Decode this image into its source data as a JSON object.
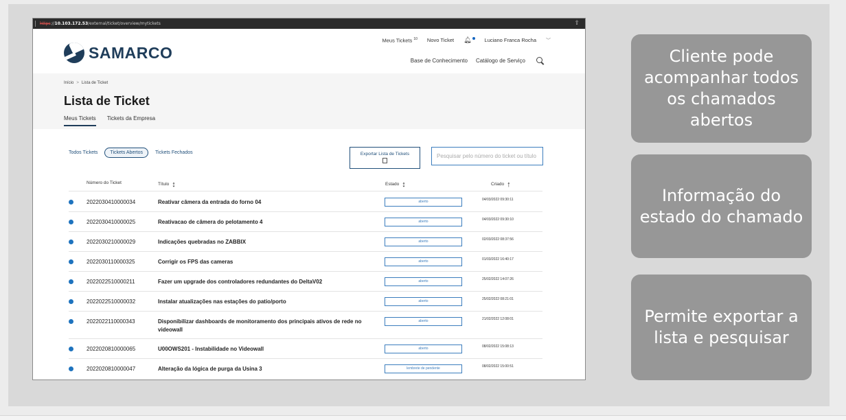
{
  "browser": {
    "url_scheme": "https",
    "url_host": "10.103.172.53",
    "url_path": "/external/ticket/overview/mytickets"
  },
  "app": {
    "logo_text": "SAMARCO",
    "top_nav": {
      "my_tickets": "Meus Tickets",
      "my_tickets_count": "10",
      "new_ticket": "Novo Ticket",
      "user_name": "Luciano Franca Rocha"
    },
    "secondary_nav": {
      "knowledge_base": "Base de Conhecimento",
      "service_catalog": "Catálogo de Serviço"
    }
  },
  "page": {
    "breadcrumb": {
      "home": "Início",
      "current": "Lista de Ticket"
    },
    "title": "Lista de Ticket",
    "tabs": [
      "Meus Tickets",
      "Tickets da Empresa"
    ]
  },
  "filters": {
    "all": "Todos Tickets",
    "open": "Tickets Abertos",
    "closed": "Tickets Fechados",
    "active": "Tickets Abertos"
  },
  "export_label": "Exportar Lista de Tickets",
  "search_placeholder": "Pesquisar pelo número do ticket ou título",
  "table": {
    "headers": {
      "number": "Número do Ticket",
      "title": "Título",
      "status": "Estado",
      "created": "Criado"
    },
    "rows": [
      {
        "number": "2022030410000034",
        "title": "Reativar câmera da entrada do forno 04",
        "status": "aberto",
        "created": "04/03/2022 09:30:11"
      },
      {
        "number": "2022030410000025",
        "title": "Reativacao de câmera do pelotamento 4",
        "status": "aberto",
        "created": "04/03/2022 09:30:10"
      },
      {
        "number": "2022030210000029",
        "title": "Indicações quebradas no ZABBIX",
        "status": "aberto",
        "created": "02/03/2022 08:37:56"
      },
      {
        "number": "2022030110000325",
        "title": "Corrigir os FPS das cameras",
        "status": "aberto",
        "created": "01/03/2022 16:40:17"
      },
      {
        "number": "2022022510000211",
        "title": "Fazer um upgrade dos controladores redundantes do DeltaV02",
        "status": "aberto",
        "created": "25/02/2022 14:07:26"
      },
      {
        "number": "2022022510000032",
        "title": "Instalar atualizações nas estações do patio/porto",
        "status": "aberto",
        "created": "25/02/2022 08:21:01"
      },
      {
        "number": "2022022110000343",
        "title": "Disponibilizar dashboards de monitoramento dos principais ativos de rede no videowall",
        "status": "aberto",
        "created": "21/02/2022 12:08:01"
      },
      {
        "number": "2022020810000065",
        "title": "U00OWS201 - Instabilidade no Videowall",
        "status": "aberto",
        "created": "08/02/2022 15:08:13"
      },
      {
        "number": "2022020810000047",
        "title": "Alteração da lógica de purga da Usina 3",
        "status": "lembrete de pendente",
        "created": "08/02/2022 15:00:51"
      }
    ]
  },
  "callouts": {
    "c1": "Cliente pode acompanhar todos os chamados abertos",
    "c2": "Informação do estado do chamado",
    "c3": "Permite exportar a lista e pesquisar"
  },
  "colors": {
    "brand": "#1f3d5a",
    "accent": "#3b7dbd",
    "status_dot": "#1e73be",
    "callout_bg": "#979797",
    "slide_bg": "#d9d9d9"
  },
  "icons": [
    "share-icon",
    "bell-icon",
    "chevron-down-icon",
    "search-icon",
    "export-file-icon",
    "sort-arrows-icon",
    "sort-up-icon"
  ]
}
